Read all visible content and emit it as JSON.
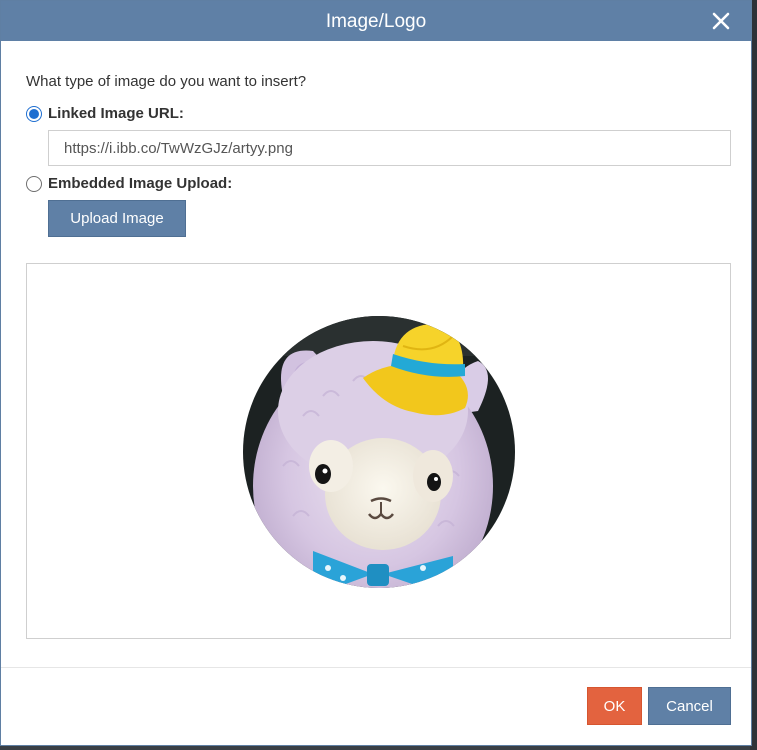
{
  "dialog": {
    "title": "Image/Logo",
    "question": "What type of image do you want to insert?",
    "options": [
      {
        "label": "Linked Image URL:",
        "selected": true
      },
      {
        "label": "Embedded Image Upload:",
        "selected": false
      }
    ],
    "url_value": "https://i.ibb.co/TwWzGJz/artyy.png",
    "upload_label": "Upload Image",
    "ok_label": "OK",
    "cancel_label": "Cancel"
  },
  "icons": {
    "close": "close-icon",
    "preview": "alpaca-plush-image"
  },
  "colors": {
    "header": "#5f80a6",
    "ok": "#e3633f",
    "radio": "#1f6fd1"
  }
}
